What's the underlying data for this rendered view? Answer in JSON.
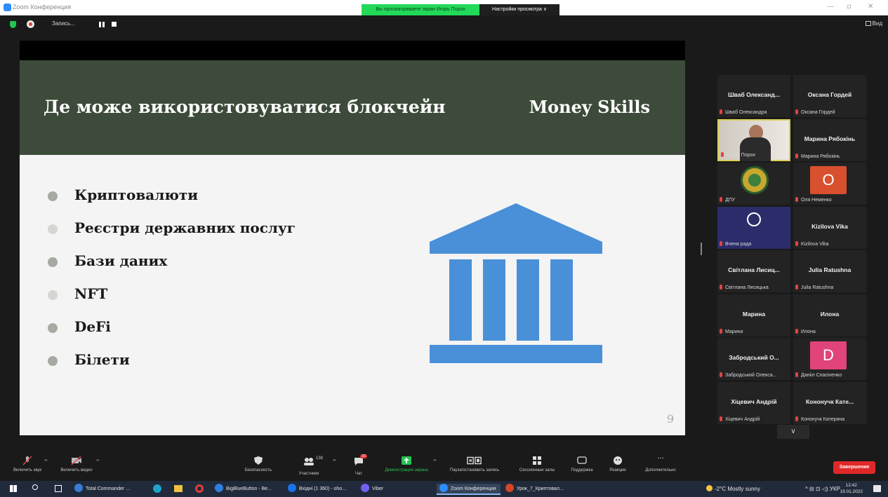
{
  "window": {
    "title": "Zoom Конференция",
    "share_banner": "Вы просматриваете экран Игорь Порох",
    "view_options": "Настройки просмотра ∨",
    "controls": [
      "—",
      "▫",
      "✕"
    ]
  },
  "meeting_top": {
    "recording_label": "Запись...",
    "view_label": "Вид"
  },
  "slide": {
    "title": "Де може використовуватися блокчейн",
    "brand": "Money Skills",
    "bullets": [
      "Криптовалюти",
      "Реєстри державних послуг",
      "Бази даних",
      "NFT",
      "DeFi",
      "Білети"
    ],
    "page_number": "9",
    "colors": {
      "header": "#3d4b3a",
      "icon": "#4a90d9",
      "bullet": "#a5aaa2",
      "background": "#f4f4f4"
    }
  },
  "gallery": [
    {
      "title": "Шваб  Олександ...",
      "label": "Шваб Олександра",
      "kind": "name"
    },
    {
      "title": "Оксана Гордей",
      "label": "Оксана Гордей",
      "kind": "name"
    },
    {
      "title": "",
      "label": "Игорь Порох",
      "kind": "video",
      "active": true
    },
    {
      "title": "Марина Рябокінь",
      "label": "Марина Рябокінь",
      "kind": "name"
    },
    {
      "title": "",
      "label": "ДПУ",
      "kind": "logo"
    },
    {
      "title": "О",
      "label": "Оля Неменко",
      "kind": "avatar",
      "color": "#d9502f"
    },
    {
      "title": "",
      "label": "Вчена рада",
      "kind": "obs"
    },
    {
      "title": "Kizilova Vika",
      "label": "Kizilova Vika",
      "kind": "name"
    },
    {
      "title": "Світлана  Лисиц...",
      "label": "Світлана Лисицька",
      "kind": "name"
    },
    {
      "title": "Julia Ratushna",
      "label": "Julia Ratushna",
      "kind": "name"
    },
    {
      "title": "Марина",
      "label": "Марина",
      "kind": "name"
    },
    {
      "title": "Илона",
      "label": "Илона",
      "kind": "name"
    },
    {
      "title": "Забродський  О...",
      "label": "Забродський Олекса...",
      "kind": "name"
    },
    {
      "title": "D",
      "label": "Данііл Спасіненко",
      "kind": "avatar",
      "color": "#e0447a"
    },
    {
      "title": "Хіцевич Андрій",
      "label": "Хіцевич Андрій",
      "kind": "name"
    },
    {
      "title": "Кононучк  Кате...",
      "label": "Кононучк Катерина",
      "kind": "name"
    }
  ],
  "gallery_scroll": "∨",
  "toolbar": {
    "audio": "Включить звук",
    "video": "Включить видео",
    "security": "Безопасность",
    "participants": "Участники",
    "participants_count": "138",
    "chat": "Чат",
    "chat_badge": "33",
    "share": "Демонстрация экрана",
    "record": "Пауза/остановить запись",
    "breakout": "Сессионные залы",
    "support": "Поддержка",
    "reactions": "Реакции",
    "more": "Дополнительно",
    "more_dots": "···",
    "end": "Завершение",
    "caret": "^"
  },
  "taskbar": {
    "apps": [
      {
        "name": "Total Commander ...",
        "color": "#3a7bd5"
      },
      {
        "name": "BigBlueButton - Be...",
        "color": "#2f7fe0"
      },
      {
        "name": "Вхідні (1 360) - oho...",
        "color": "#1a73e8"
      },
      {
        "name": "Viber",
        "color": "#7360f2"
      },
      {
        "name": "Zoom Конференция",
        "color": "#2d8cff",
        "active": true
      },
      {
        "name": "Урок_7_Криптовал...",
        "color": "#d24726"
      }
    ],
    "weather": "-2°C  Mostly sunny",
    "tray": "^  ⊟  ⊡  ◁)  УКР",
    "time": "12:42",
    "date": "19.01.2022"
  }
}
